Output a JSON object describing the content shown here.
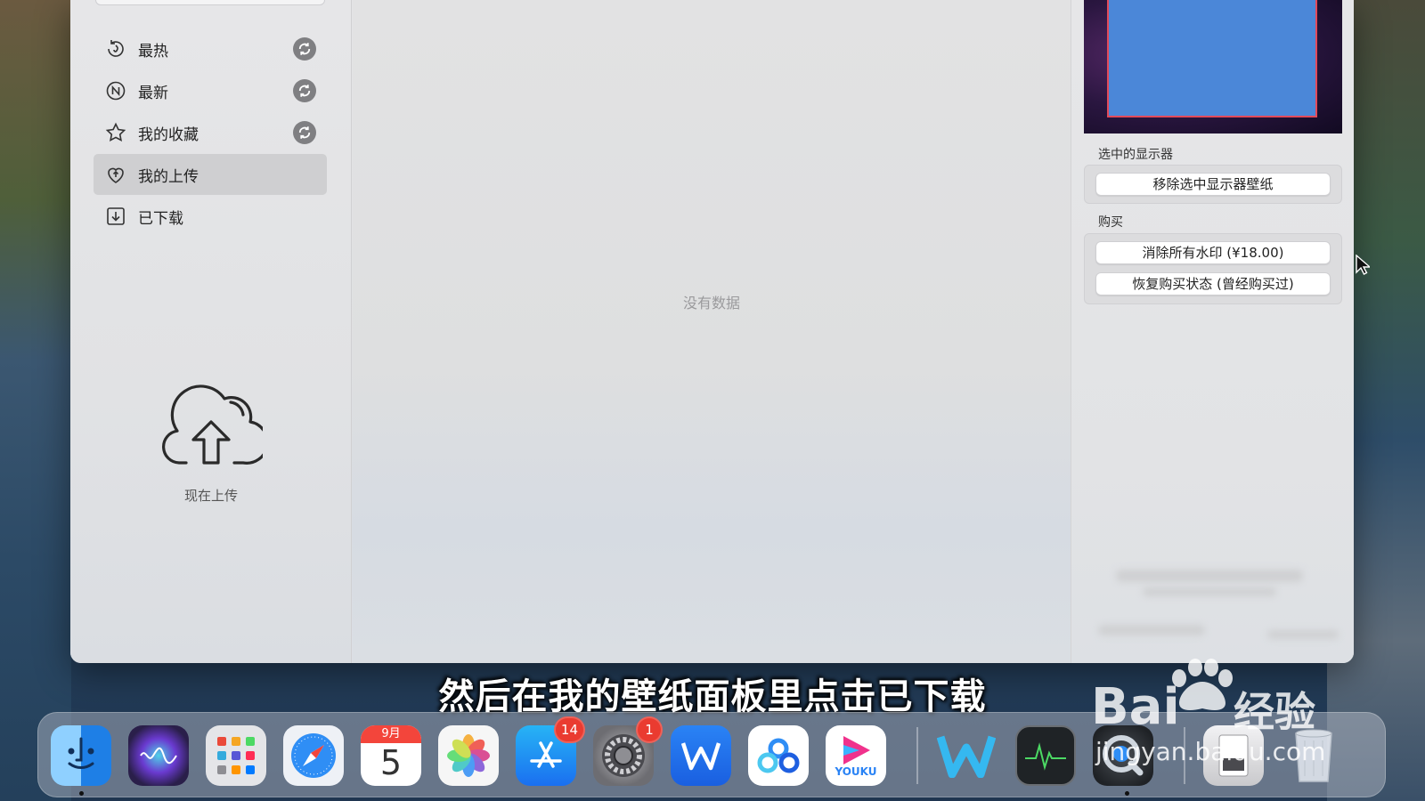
{
  "sidebar": {
    "items": [
      {
        "label": "最热",
        "icon": "hot-icon",
        "refresh": true
      },
      {
        "label": "最新",
        "icon": "new-icon",
        "refresh": true
      },
      {
        "label": "我的收藏",
        "icon": "star-icon",
        "refresh": true
      },
      {
        "label": "我的上传",
        "icon": "heart-upload-icon",
        "refresh": false,
        "active": true
      },
      {
        "label": "已下载",
        "icon": "download-icon",
        "refresh": false
      }
    ],
    "upload_label": "现在上传"
  },
  "content": {
    "empty_text": "没有数据"
  },
  "panel": {
    "selected_display_label": "选中的显示器",
    "remove_wallpaper_button": "移除选中显示器壁纸",
    "purchase_label": "购买",
    "remove_watermark_button": "消除所有水印 (¥18.00)",
    "restore_purchase_button": "恢复购买状态 (曾经购买过)"
  },
  "subtitle": "然后在我的壁纸面板里点击已下载",
  "dock": {
    "apps": [
      {
        "name": "finder",
        "color": "#3d9bf0"
      },
      {
        "name": "siri",
        "color": "#2a1f4a"
      },
      {
        "name": "launchpad",
        "color": "#d9dadd"
      },
      {
        "name": "safari",
        "color": "#e9eef5"
      },
      {
        "name": "calendar",
        "color": "#ffffff",
        "month": "9月",
        "day": "5"
      },
      {
        "name": "photos",
        "color": "#f5f5f5"
      },
      {
        "name": "app-store",
        "color": "#1e8df0",
        "badge": "14"
      },
      {
        "name": "system-preferences",
        "color": "#8a8a8e",
        "badge": "1"
      },
      {
        "name": "wps",
        "color": "#1e6ff2"
      },
      {
        "name": "baidu-netdisk",
        "color": "#ffffff"
      },
      {
        "name": "youku",
        "color": "#ffffff"
      },
      {
        "name": "wallpaper-app",
        "color": "transparent"
      },
      {
        "name": "activity-monitor",
        "color": "#1f2326"
      },
      {
        "name": "quicktime",
        "color": "#2a2e33"
      },
      {
        "name": "downloads-stack",
        "color": "#e8e8ea"
      },
      {
        "name": "trash",
        "color": "#dfe3e8"
      }
    ]
  },
  "watermark": {
    "brand": "Bai",
    "jingyan": "经验",
    "url": "jingyan.baidu.com"
  }
}
